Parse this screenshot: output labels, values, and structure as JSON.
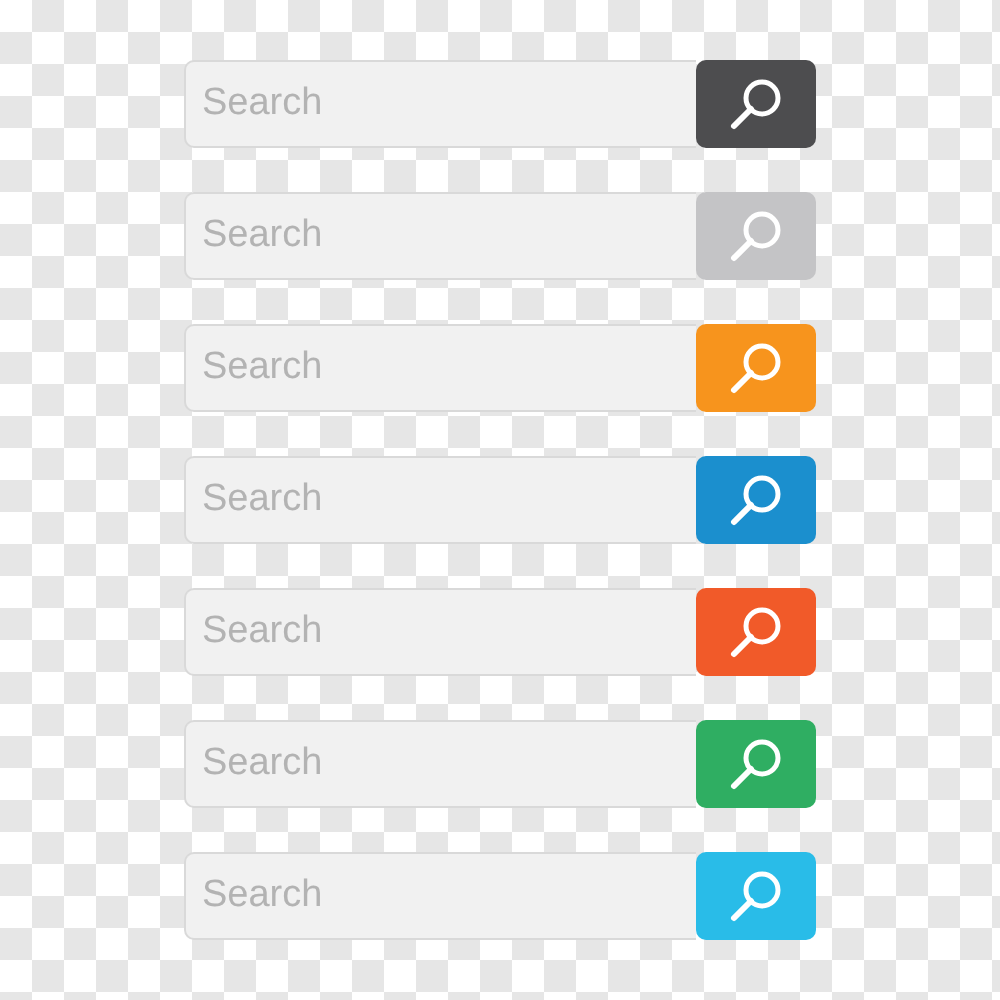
{
  "search_bars": [
    {
      "placeholder": "Search",
      "color": "#4d4d4f"
    },
    {
      "placeholder": "Search",
      "color": "#c4c4c6"
    },
    {
      "placeholder": "Search",
      "color": "#f7941d"
    },
    {
      "placeholder": "Search",
      "color": "#1b8fce"
    },
    {
      "placeholder": "Search",
      "color": "#f15a29"
    },
    {
      "placeholder": "Search",
      "color": "#2fae62"
    },
    {
      "placeholder": "Search",
      "color": "#29bce8"
    }
  ]
}
